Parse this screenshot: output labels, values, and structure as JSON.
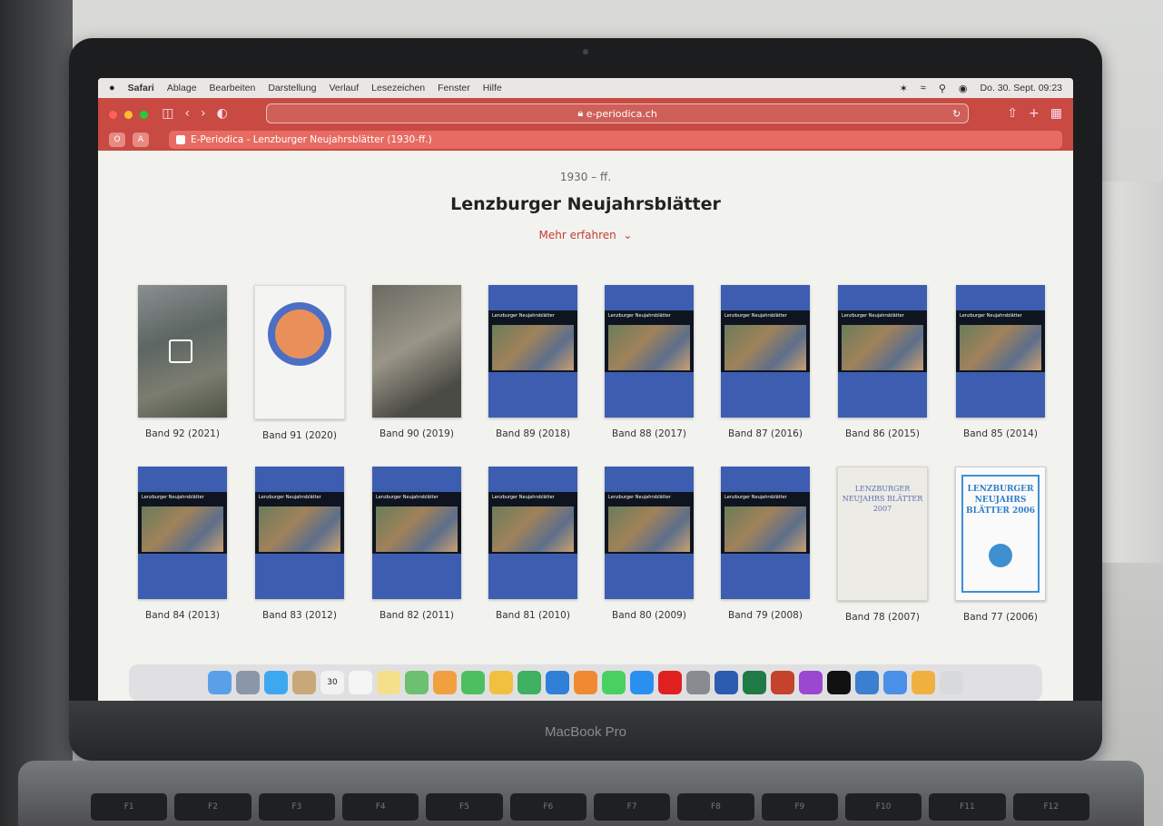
{
  "menubar": {
    "apple": "",
    "app": "Safari",
    "items": [
      "Ablage",
      "Bearbeiten",
      "Darstellung",
      "Verlauf",
      "Lesezeichen",
      "Fenster",
      "Hilfe"
    ],
    "clock": "Do. 30. Sept. 09:23"
  },
  "toolbar": {
    "url": "e-periodica.ch"
  },
  "tab": {
    "title": "E-Periodica - Lenzburger Neujahrsblätter (1930-ff.)",
    "pill1": "O",
    "pill2": "A"
  },
  "page": {
    "years": "1930 – ff.",
    "title": "Lenzburger Neujahrsblätter",
    "more": "Mehr erfahren"
  },
  "covers": [
    {
      "label": "Band 92 (2021)",
      "style": "photo-old"
    },
    {
      "label": "Band 91 (2020)",
      "style": "plate"
    },
    {
      "label": "Band 90 (2019)",
      "style": "crowd"
    },
    {
      "label": "Band 89 (2018)",
      "style": "blue"
    },
    {
      "label": "Band 88 (2017)",
      "style": "blue"
    },
    {
      "label": "Band 87 (2016)",
      "style": "blue"
    },
    {
      "label": "Band 86 (2015)",
      "style": "blue"
    },
    {
      "label": "Band 85 (2014)",
      "style": "blue"
    },
    {
      "label": "Band 84 (2013)",
      "style": "blue"
    },
    {
      "label": "Band 83 (2012)",
      "style": "blue"
    },
    {
      "label": "Band 82 (2011)",
      "style": "blue"
    },
    {
      "label": "Band 81 (2010)",
      "style": "blue"
    },
    {
      "label": "Band 80 (2009)",
      "style": "blue"
    },
    {
      "label": "Band 79 (2008)",
      "style": "blue"
    },
    {
      "label": "Band 78 (2007)",
      "style": "paper"
    },
    {
      "label": "Band 77 (2006)",
      "style": "framed"
    }
  ],
  "cover_text": {
    "blue_header": "Lenzburger Neujahrsblätter",
    "paper_title": "LENZBURGER NEUJAHRS BLÄTTER 2007",
    "framed_title": "LENZBURGER NEUJAHRS BLÄTTER 2006"
  },
  "dock": {
    "calendar_day": "30",
    "apps": [
      "finder",
      "launchpad",
      "safari",
      "contacts",
      "calendar",
      "reminders",
      "notes",
      "maps",
      "photos",
      "facetime",
      "freeform",
      "numbers",
      "keynote",
      "books",
      "messages",
      "app-store",
      "acrobat",
      "settings",
      "word",
      "excel",
      "powerpoint",
      "podcasts",
      "apple-tv",
      "preview",
      "mail",
      "pages",
      "trash"
    ],
    "colors": [
      "#5aa0e8",
      "#8b97a8",
      "#3da8f0",
      "#c8a878",
      "#f2f2f2",
      "#f5f5f5",
      "#f4e08a",
      "#6cc070",
      "#f0a040",
      "#4cc060",
      "#f0c040",
      "#3eb060",
      "#3080d8",
      "#f08a30",
      "#48d060",
      "#2a90f0",
      "#e02020",
      "#888c90",
      "#2b5cb0",
      "#1f7a45",
      "#c4432a",
      "#9a48d0",
      "#111111",
      "#3a7fd0",
      "#4a90e8",
      "#f0b040",
      "#d8dadc"
    ]
  },
  "macbook": "MacBook Pro",
  "keyboard_keys": [
    "F1",
    "F2",
    "F3",
    "F4",
    "F5",
    "F6",
    "F7",
    "F8",
    "F9",
    "F10",
    "F11",
    "F12"
  ]
}
